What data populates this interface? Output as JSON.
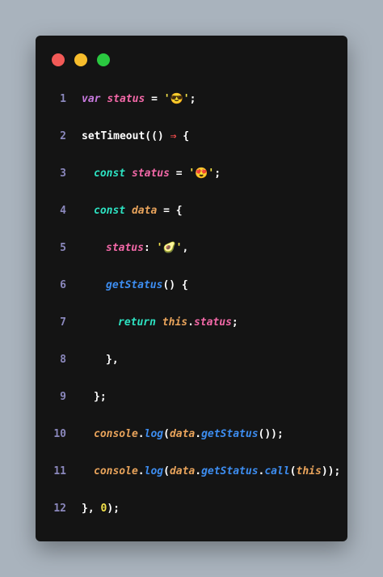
{
  "colors": {
    "background": "#a9b3bd",
    "window": "#141414",
    "red_dot": "#f25a57",
    "yellow_dot": "#f7bd2c",
    "green_dot": "#2ac840",
    "line_number": "#8b88bd",
    "plain": "#ffffff",
    "keyword_purple": "#c679dd",
    "keyword_teal": "#2de2c2",
    "identifier_pink": "#f268a7",
    "identifier_orange": "#e8a35b",
    "string_yellow": "#f2e14a",
    "method_blue": "#3d8df0",
    "arrow_red": "#ff4f4f",
    "number_yellow": "#f2e14a"
  },
  "window_controls": [
    "close",
    "minimize",
    "maximize"
  ],
  "code": [
    {
      "n": "1",
      "indent": 0,
      "tokens": [
        {
          "t": "var",
          "c": "#c679dd",
          "i": true
        },
        {
          "t": " "
        },
        {
          "t": "status",
          "c": "#f268a7",
          "i": true
        },
        {
          "t": " = ",
          "c": "#ffffff"
        },
        {
          "t": "'😎'",
          "c": "#f2e14a"
        },
        {
          "t": ";",
          "c": "#ffffff"
        }
      ]
    },
    {
      "n": "2",
      "indent": 0,
      "tokens": [
        {
          "t": "setTimeout(() ",
          "c": "#ffffff"
        },
        {
          "t": "⇒",
          "c": "#ff4f4f"
        },
        {
          "t": " {",
          "c": "#ffffff"
        }
      ]
    },
    {
      "n": "3",
      "indent": 1,
      "tokens": [
        {
          "t": "const",
          "c": "#2de2c2",
          "i": true
        },
        {
          "t": " "
        },
        {
          "t": "status",
          "c": "#f268a7",
          "i": true
        },
        {
          "t": " = ",
          "c": "#ffffff"
        },
        {
          "t": "'😍'",
          "c": "#f2e14a"
        },
        {
          "t": ";",
          "c": "#ffffff"
        }
      ]
    },
    {
      "n": "4",
      "indent": 1,
      "tokens": [
        {
          "t": "const",
          "c": "#2de2c2",
          "i": true
        },
        {
          "t": " "
        },
        {
          "t": "data",
          "c": "#e8a35b",
          "i": true
        },
        {
          "t": " = {",
          "c": "#ffffff"
        }
      ]
    },
    {
      "n": "5",
      "indent": 2,
      "tokens": [
        {
          "t": "status",
          "c": "#f268a7",
          "i": true
        },
        {
          "t": ": ",
          "c": "#ffffff"
        },
        {
          "t": "'🥑'",
          "c": "#f2e14a"
        },
        {
          "t": ",",
          "c": "#ffffff"
        }
      ]
    },
    {
      "n": "6",
      "indent": 2,
      "tokens": [
        {
          "t": "getStatus",
          "c": "#3d8df0",
          "i": true
        },
        {
          "t": "() {",
          "c": "#ffffff"
        }
      ]
    },
    {
      "n": "7",
      "indent": 3,
      "tokens": [
        {
          "t": "return",
          "c": "#2de2c2",
          "i": true
        },
        {
          "t": " "
        },
        {
          "t": "this",
          "c": "#e8a35b",
          "i": true
        },
        {
          "t": ".",
          "c": "#ffffff"
        },
        {
          "t": "status",
          "c": "#f268a7",
          "i": true
        },
        {
          "t": ";",
          "c": "#ffffff"
        }
      ]
    },
    {
      "n": "8",
      "indent": 2,
      "tokens": [
        {
          "t": "},",
          "c": "#ffffff"
        }
      ]
    },
    {
      "n": "9",
      "indent": 1,
      "tokens": [
        {
          "t": "};",
          "c": "#ffffff"
        }
      ]
    },
    {
      "n": "10",
      "indent": 1,
      "tokens": [
        {
          "t": "console",
          "c": "#e8a35b",
          "i": true
        },
        {
          "t": ".",
          "c": "#ffffff"
        },
        {
          "t": "log",
          "c": "#3d8df0",
          "i": true
        },
        {
          "t": "(",
          "c": "#ffffff"
        },
        {
          "t": "data",
          "c": "#e8a35b",
          "i": true
        },
        {
          "t": ".",
          "c": "#ffffff"
        },
        {
          "t": "getStatus",
          "c": "#3d8df0",
          "i": true
        },
        {
          "t": "());",
          "c": "#ffffff"
        }
      ]
    },
    {
      "n": "11",
      "indent": 1,
      "tokens": [
        {
          "t": "console",
          "c": "#e8a35b",
          "i": true
        },
        {
          "t": ".",
          "c": "#ffffff"
        },
        {
          "t": "log",
          "c": "#3d8df0",
          "i": true
        },
        {
          "t": "(",
          "c": "#ffffff"
        },
        {
          "t": "data",
          "c": "#e8a35b",
          "i": true
        },
        {
          "t": ".",
          "c": "#ffffff"
        },
        {
          "t": "getStatus",
          "c": "#3d8df0",
          "i": true
        },
        {
          "t": ".",
          "c": "#ffffff"
        },
        {
          "t": "call",
          "c": "#3d8df0",
          "i": true
        },
        {
          "t": "(",
          "c": "#ffffff"
        },
        {
          "t": "this",
          "c": "#e8a35b",
          "i": true
        },
        {
          "t": "));",
          "c": "#ffffff"
        }
      ]
    },
    {
      "n": "12",
      "indent": 0,
      "tokens": [
        {
          "t": "}, ",
          "c": "#ffffff"
        },
        {
          "t": "0",
          "c": "#f2e14a"
        },
        {
          "t": ");",
          "c": "#ffffff"
        }
      ]
    }
  ]
}
